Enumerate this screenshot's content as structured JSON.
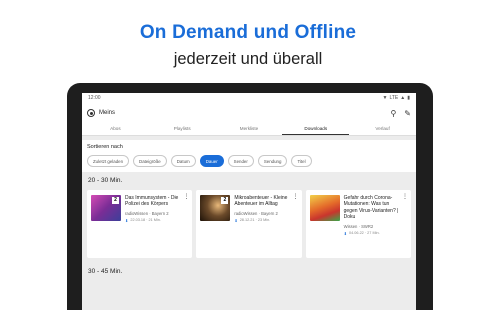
{
  "headline": "On Demand und Offline",
  "subline": "jederzeit und überall",
  "statusbar": {
    "time": "12:00",
    "icons": [
      "▼",
      "LTE",
      "▲",
      "▮"
    ]
  },
  "appbar": {
    "title": "Meins"
  },
  "tabs": [
    {
      "label": "Abos",
      "active": false
    },
    {
      "label": "Playlists",
      "active": false
    },
    {
      "label": "Merkliste",
      "active": false
    },
    {
      "label": "Downloads",
      "active": true
    },
    {
      "label": "Verlauf",
      "active": false
    }
  ],
  "sort": {
    "title": "Sortieren nach",
    "options": [
      "Zuletzt geladen",
      "Dateigröße",
      "Datum",
      "Dauer",
      "Sender",
      "Sendung",
      "Titel"
    ],
    "selected": "Dauer"
  },
  "groups": [
    {
      "label": "20 - 30 Min."
    },
    {
      "label": "30 - 45 Min."
    }
  ],
  "cards": [
    {
      "title": "Das Immunsystem - Die Polizei des Körpers",
      "meta": "radioWissen · Bayern 2",
      "sub": "22.03.18 · 21 Min."
    },
    {
      "title": "Mikroabenteuer - Kleine Abenteuer im Alltag",
      "meta": "radioWissen · Bayern 2",
      "sub": "28.12.21 · 23 Min."
    },
    {
      "title": "Gefahr durch Corona-Mutationen: Was tun gegen Virus-Varianten? | Doku",
      "meta": "Wissen · SWR2",
      "sub": "04.06.22 · 27 Min."
    }
  ],
  "colors": {
    "accent": "#1a6dd8",
    "device": "#1e1e1e",
    "screen_bg": "#ececec"
  }
}
